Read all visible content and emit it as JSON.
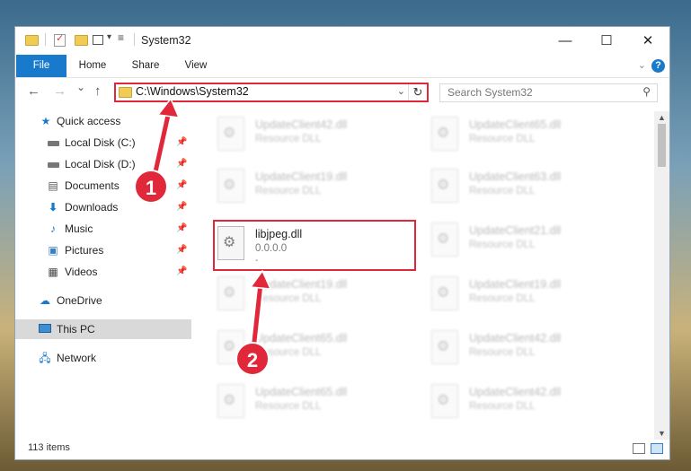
{
  "window": {
    "title": "System32",
    "controls": {
      "minimize": "—",
      "maximize": "☐",
      "close": "✕"
    }
  },
  "ribbon": {
    "tabs": [
      "File",
      "Home",
      "Share",
      "View"
    ],
    "help": "?"
  },
  "nav": {
    "back": "←",
    "forward": "→",
    "recent": "⌄",
    "up": "↑",
    "address": "C:\\Windows\\System32",
    "search_placeholder": "Search System32"
  },
  "sidebar": {
    "items": [
      {
        "label": "Quick access",
        "icon": "star-icon",
        "pinned": false
      },
      {
        "label": "Local Disk (C:)",
        "icon": "drive-icon",
        "pinned": true
      },
      {
        "label": "Local Disk (D:)",
        "icon": "drive-icon",
        "pinned": true
      },
      {
        "label": "Documents",
        "icon": "documents-icon",
        "pinned": true
      },
      {
        "label": "Downloads",
        "icon": "download-icon",
        "pinned": true
      },
      {
        "label": "Music",
        "icon": "music-icon",
        "pinned": true
      },
      {
        "label": "Pictures",
        "icon": "pictures-icon",
        "pinned": true
      },
      {
        "label": "Videos",
        "icon": "videos-icon",
        "pinned": true
      },
      {
        "label": "OneDrive",
        "icon": "cloud-icon",
        "pinned": false
      },
      {
        "label": "This PC",
        "icon": "computer-icon",
        "pinned": false,
        "selected": true
      },
      {
        "label": "Network",
        "icon": "network-icon",
        "pinned": false
      }
    ]
  },
  "files": [
    {
      "name": "UpdateClient42.dll",
      "desc": "Resource DLL"
    },
    {
      "name": "UpdateClient65.dll",
      "desc": "Resource DLL"
    },
    {
      "name": "UpdateClient19.dll",
      "desc": "Resource DLL"
    },
    {
      "name": "UpdateClient63.dll",
      "desc": "Resource DLL"
    },
    {
      "name": "libjpeg.dll",
      "desc": "0.0.0.0",
      "extra": "-",
      "highlighted": true
    },
    {
      "name": "UpdateClient21.dll",
      "desc": "Resource DLL"
    },
    {
      "name": "UpdateClient19.dll",
      "desc": "Resource DLL"
    },
    {
      "name": "UpdateClient19.dll",
      "desc": "Resource DLL"
    },
    {
      "name": "UpdateClient65.dll",
      "desc": "Resource DLL"
    },
    {
      "name": "UpdateClient42.dll",
      "desc": "Resource DLL"
    },
    {
      "name": "UpdateClient65.dll",
      "desc": "Resource DLL"
    },
    {
      "name": "UpdateClient42.dll",
      "desc": "Resource DLL"
    }
  ],
  "status": {
    "count": "113 items"
  },
  "callouts": [
    "1",
    "2"
  ],
  "colors": {
    "accent": "#1979ca",
    "highlight": "#e0283a"
  }
}
